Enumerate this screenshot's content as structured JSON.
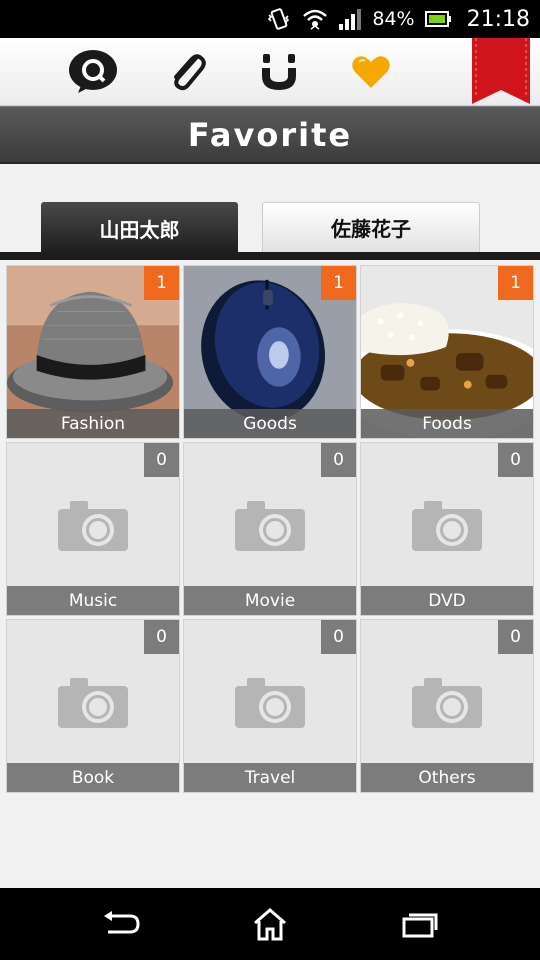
{
  "status_bar": {
    "battery_percent": "84%",
    "time": "21:18",
    "icons": [
      "vibrate-icon",
      "wifi-icon",
      "signal-icon",
      "battery-icon"
    ]
  },
  "toolbar": {
    "icons": [
      "search-app-icon",
      "paperclip-icon",
      "smile-icon",
      "heart-icon",
      "bookmark-ribbon-icon"
    ]
  },
  "header": {
    "title": "Favorite"
  },
  "tabs": [
    {
      "label": "山田太郎",
      "active": true
    },
    {
      "label": "佐藤花子",
      "active": false
    }
  ],
  "categories": [
    {
      "label": "Fashion",
      "count": "1",
      "has_photo": true
    },
    {
      "label": "Goods",
      "count": "1",
      "has_photo": true
    },
    {
      "label": "Foods",
      "count": "1",
      "has_photo": true
    },
    {
      "label": "Music",
      "count": "0",
      "has_photo": false
    },
    {
      "label": "Movie",
      "count": "0",
      "has_photo": false
    },
    {
      "label": "DVD",
      "count": "0",
      "has_photo": false
    },
    {
      "label": "Book",
      "count": "0",
      "has_photo": false
    },
    {
      "label": "Travel",
      "count": "0",
      "has_photo": false
    },
    {
      "label": "Others",
      "count": "0",
      "has_photo": false
    }
  ],
  "colors": {
    "accent_badge": "#ef6a1f",
    "empty_badge": "#7c7c7c",
    "title_bar": "#444444",
    "heart": "#f5a800",
    "ribbon": "#d0141c"
  },
  "nav_bar": {
    "icons": [
      "back-icon",
      "home-icon",
      "recent-apps-icon"
    ]
  }
}
